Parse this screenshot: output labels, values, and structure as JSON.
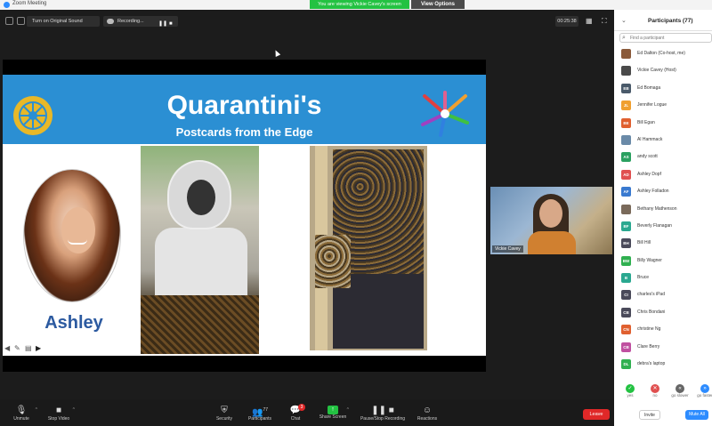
{
  "window": {
    "app_title": "Zoom Meeting"
  },
  "banner": {
    "viewing": "You are viewing Vickie Cavey's screen",
    "view_options": "View Options"
  },
  "topbar": {
    "audio_label": "Turn on Original Sound",
    "recording_label": "Recording...",
    "pause": "❚❚",
    "stop": "■",
    "timer": "00:25:38"
  },
  "slide": {
    "title": "Quarantini's",
    "subtitle": "Postcards from the Edge",
    "person_name": "Ashley"
  },
  "video": {
    "participant_name": "Vickie Cavey"
  },
  "toolbar": {
    "unmute": "Unmute",
    "stop_video": "Stop Video",
    "security": "Security",
    "participants": "Participants",
    "participants_count": "77",
    "chat": "Chat",
    "chat_badge": "3",
    "share_screen": "Share Screen",
    "pause_recording": "Pause/Stop Recording",
    "reactions": "Reactions",
    "leave": "Leave"
  },
  "participants_panel": {
    "title": "Participants (77)",
    "search_placeholder": "Find a participant",
    "items": [
      {
        "name": "Ed Dalton (Co-host, me)",
        "initials": "",
        "color": "#8a5a3a"
      },
      {
        "name": "Vickie Cavey (Host)",
        "initials": "",
        "color": "#4a4a4a"
      },
      {
        "name": "Ed Bomaga",
        "initials": "EB",
        "color": "#4a5a6a"
      },
      {
        "name": "Jennifer Logue",
        "initials": "JL",
        "color": "#f0a030"
      },
      {
        "name": "Bill Egan",
        "initials": "BE",
        "color": "#e06030"
      },
      {
        "name": "Al Hammack",
        "initials": "",
        "color": "#6a8aa8"
      },
      {
        "name": "andy scott",
        "initials": "AS",
        "color": "#2aa060"
      },
      {
        "name": "Ashley Dopf",
        "initials": "AD",
        "color": "#e05050"
      },
      {
        "name": "Ashley Folladon",
        "initials": "AF",
        "color": "#3a7ad0"
      },
      {
        "name": "Bethany Mathenson",
        "initials": "",
        "color": "#7a6a5a"
      },
      {
        "name": "Beverly Flanagan",
        "initials": "BF",
        "color": "#2aa890"
      },
      {
        "name": "Bill Hill",
        "initials": "BH",
        "color": "#4a4a5a"
      },
      {
        "name": "Billy Wagner",
        "initials": "BW",
        "color": "#30b050"
      },
      {
        "name": "Bruce",
        "initials": "B",
        "color": "#2aa890"
      },
      {
        "name": "charles's iPad",
        "initials": "CI",
        "color": "#4a4a5a"
      },
      {
        "name": "Chris Bondani",
        "initials": "CB",
        "color": "#4a4a5a"
      },
      {
        "name": "christine Ng",
        "initials": "CN",
        "color": "#e06030"
      },
      {
        "name": "Clare Berry",
        "initials": "CB",
        "color": "#c050a0"
      },
      {
        "name": "debra's laptop",
        "initials": "DL",
        "color": "#30b050"
      }
    ],
    "reactions": [
      {
        "label": "yes",
        "glyph": "✓",
        "color": "#23c242"
      },
      {
        "label": "no",
        "glyph": "✕",
        "color": "#e05050"
      },
      {
        "label": "go slower",
        "glyph": "«",
        "color": "#666"
      },
      {
        "label": "go faster",
        "glyph": "»",
        "color": "#2d8cff"
      }
    ],
    "invite": "Invite",
    "mute_all": "Mute All"
  }
}
